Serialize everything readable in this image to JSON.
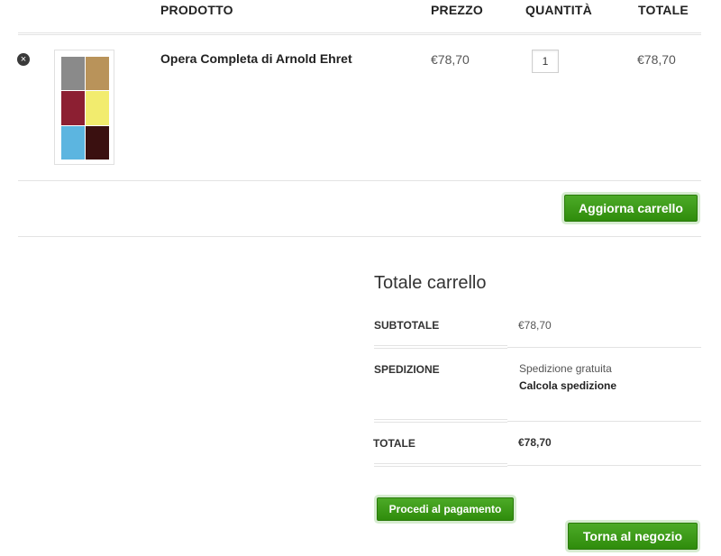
{
  "table": {
    "headers": {
      "product": "PRODOTTO",
      "price": "PREZZO",
      "quantity": "QUANTITÀ",
      "total": "TOTALE"
    },
    "item": {
      "remove_glyph": "×",
      "remove_icon": "remove-icon",
      "name": "Opera Completa di Arnold Ehret",
      "price": "€78,70",
      "quantity": "1",
      "total": "€78,70",
      "thumbnail_colors": [
        "#8a8a8a",
        "#b9935a",
        "#8c1f32",
        "#f2ec6e",
        "#5cb5e0",
        "#3a1010"
      ]
    }
  },
  "actions": {
    "update_cart": "Aggiorna carrello",
    "checkout": "Procedi al pagamento",
    "back_to_shop": "Torna al negozio"
  },
  "totals": {
    "title": "Totale carrello",
    "subtotal_label": "SUBTOTALE",
    "subtotal_value": "€78,70",
    "shipping_label": "SPEDIZIONE",
    "shipping_value": "Spedizione gratuita",
    "shipping_calc": "Calcola spedizione",
    "total_label": "TOTALE",
    "total_value": "€78,70"
  },
  "colors": {
    "button_green": "#3a9a17",
    "text_dark": "#222222"
  }
}
